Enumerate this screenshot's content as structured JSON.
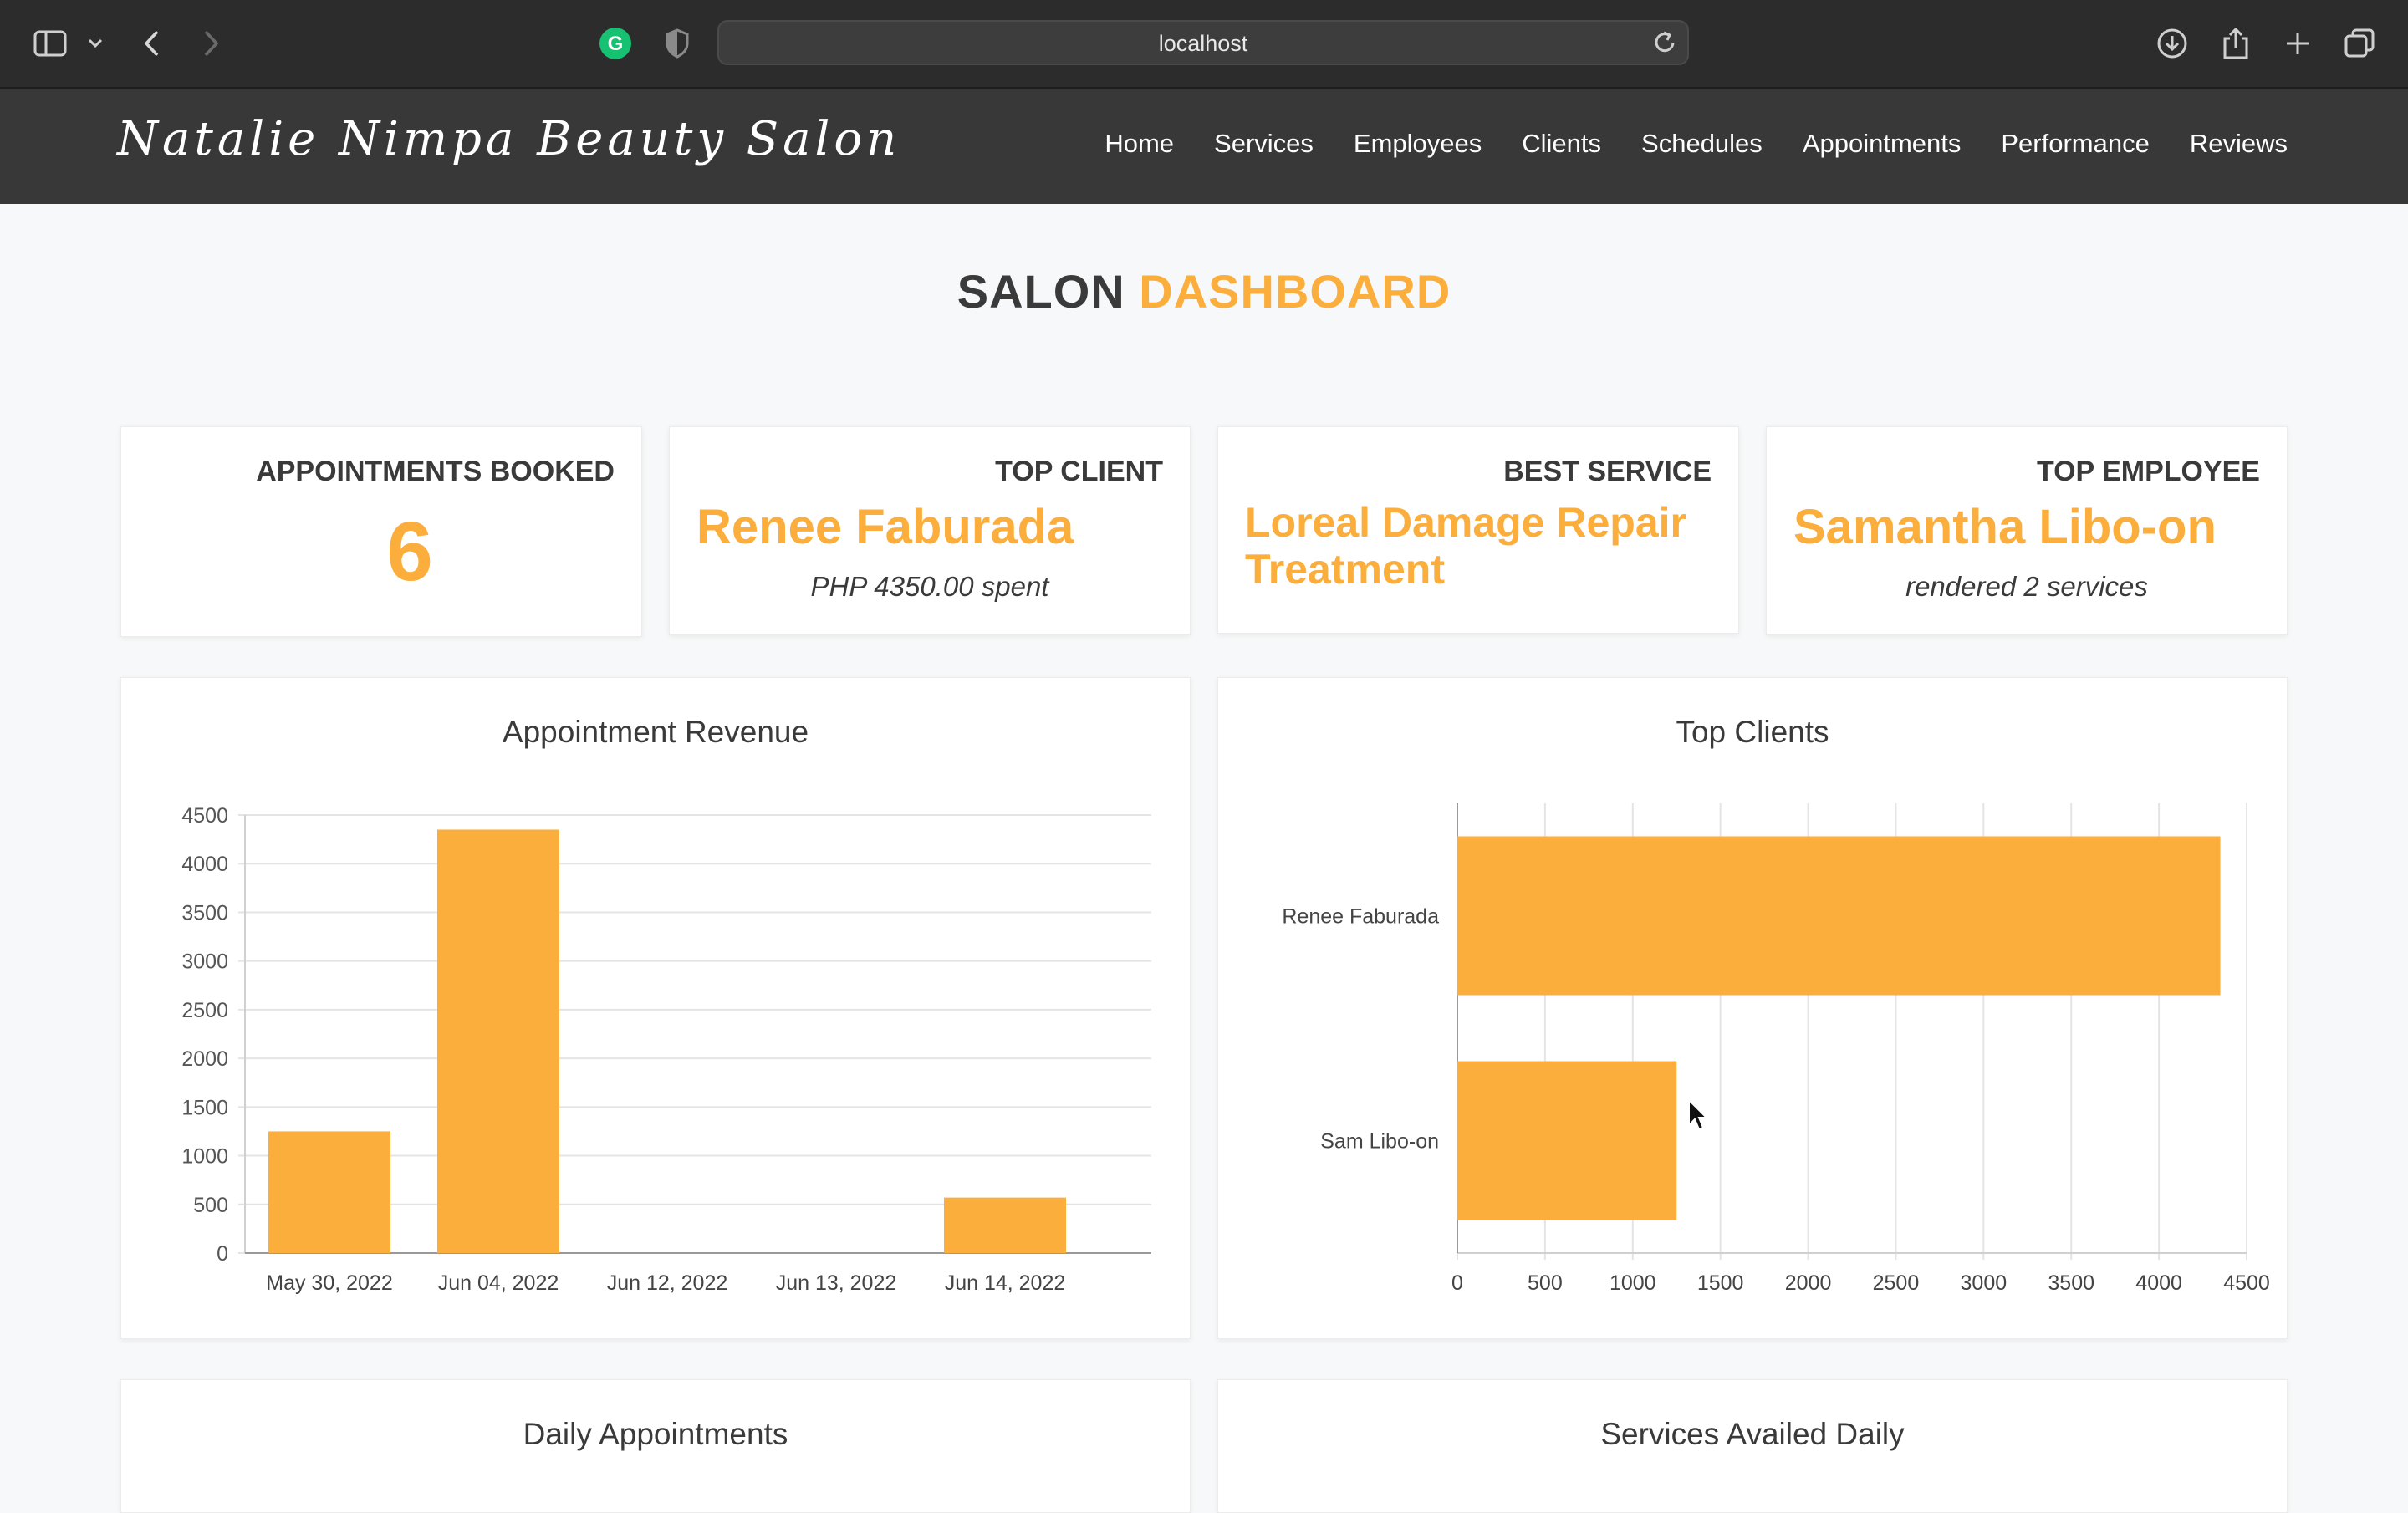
{
  "browser": {
    "url": "localhost",
    "icons": [
      "sidebar-icon",
      "chevron-down-icon",
      "back-icon",
      "forward-icon",
      "grammarly-icon",
      "shield-icon",
      "reload-icon",
      "download-icon",
      "share-icon",
      "new-tab-icon",
      "tabs-overview-icon"
    ]
  },
  "navbar": {
    "brand": "Natalie Nimpa Beauty Salon",
    "links": [
      "Home",
      "Services",
      "Employees",
      "Clients",
      "Schedules",
      "Appointments",
      "Performance",
      "Reviews"
    ]
  },
  "heading": {
    "part1": "SALON",
    "part2": "DASHBOARD"
  },
  "stats": {
    "appointments": {
      "label": "APPOINTMENTS BOOKED",
      "value": "6"
    },
    "top_client": {
      "label": "TOP CLIENT",
      "value": "Renee Faburada",
      "sub": "PHP 4350.00 spent"
    },
    "best_service": {
      "label": "BEST SERVICE",
      "value": "Loreal Damage Repair Treatment"
    },
    "top_employee": {
      "label": "TOP EMPLOYEE",
      "value": "Samantha Libo-on",
      "sub": "rendered 2 services"
    }
  },
  "colors": {
    "accent": "#fbae3c",
    "navbar": "#383838",
    "chrome": "#2c2c2c"
  },
  "chart_data": [
    {
      "type": "bar",
      "title": "Appointment Revenue",
      "categories": [
        "May 30, 2022",
        "Jun 04, 2022",
        "Jun 12, 2022",
        "Jun 13, 2022",
        "Jun 14, 2022"
      ],
      "values": [
        1250,
        4350,
        0,
        0,
        570
      ],
      "ylim": [
        0,
        4500
      ],
      "yticks": [
        0,
        500,
        1000,
        1500,
        2000,
        2500,
        3000,
        3500,
        4000,
        4500
      ],
      "grid": true,
      "color": "#fbae3c"
    },
    {
      "type": "bar",
      "orientation": "horizontal",
      "title": "Top Clients",
      "categories": [
        "Renee Faburada",
        "Sam Libo-on"
      ],
      "values": [
        4350,
        1250
      ],
      "xlim": [
        0,
        4500
      ],
      "xticks": [
        0,
        500,
        1000,
        1500,
        2000,
        2500,
        3000,
        3500,
        4000,
        4500
      ],
      "grid": true,
      "color": "#fbae3c"
    }
  ],
  "lower_charts": {
    "daily_appointments": {
      "title": "Daily Appointments"
    },
    "services_daily": {
      "title": "Services Availed Daily"
    }
  }
}
